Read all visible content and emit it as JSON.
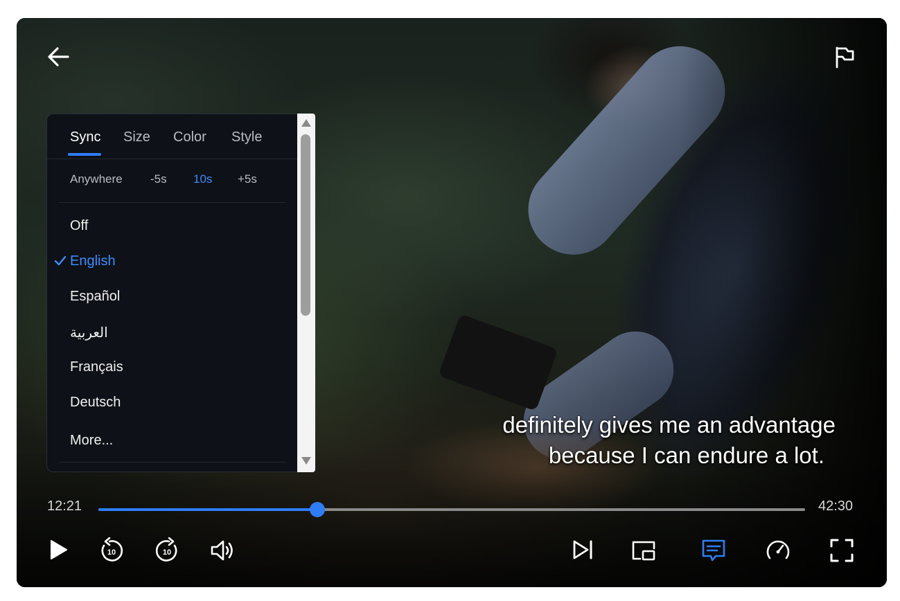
{
  "subtitle_menu": {
    "tabs": [
      "Sync",
      "Size",
      "Color",
      "Style"
    ],
    "active_tab": "Sync",
    "sync_options": [
      "Anywhere",
      "-5s",
      "10s",
      "+5s"
    ],
    "active_sync": "10s",
    "languages": [
      "Off",
      "English",
      "Español",
      "العربية",
      "Français",
      "Deutsch",
      "More..."
    ],
    "selected_language": "English"
  },
  "subtitle": {
    "line1": "definitely gives me an advantage",
    "line2": "because I can endure a lot."
  },
  "playback": {
    "current_time": "12:21",
    "total_time": "42:30",
    "progress": 0.31
  },
  "icons": {
    "top_left": "back-arrow-icon",
    "top_right": "flag-icon",
    "controls": [
      "play-icon",
      "rewind-10-icon",
      "forward-10-icon",
      "volume-icon",
      "next-icon",
      "picture-in-picture-icon",
      "subtitles-icon",
      "playback-speed-icon",
      "fullscreen-icon"
    ]
  },
  "colors": {
    "accent": "#2f7df6",
    "menu_background": "#0e1117"
  }
}
